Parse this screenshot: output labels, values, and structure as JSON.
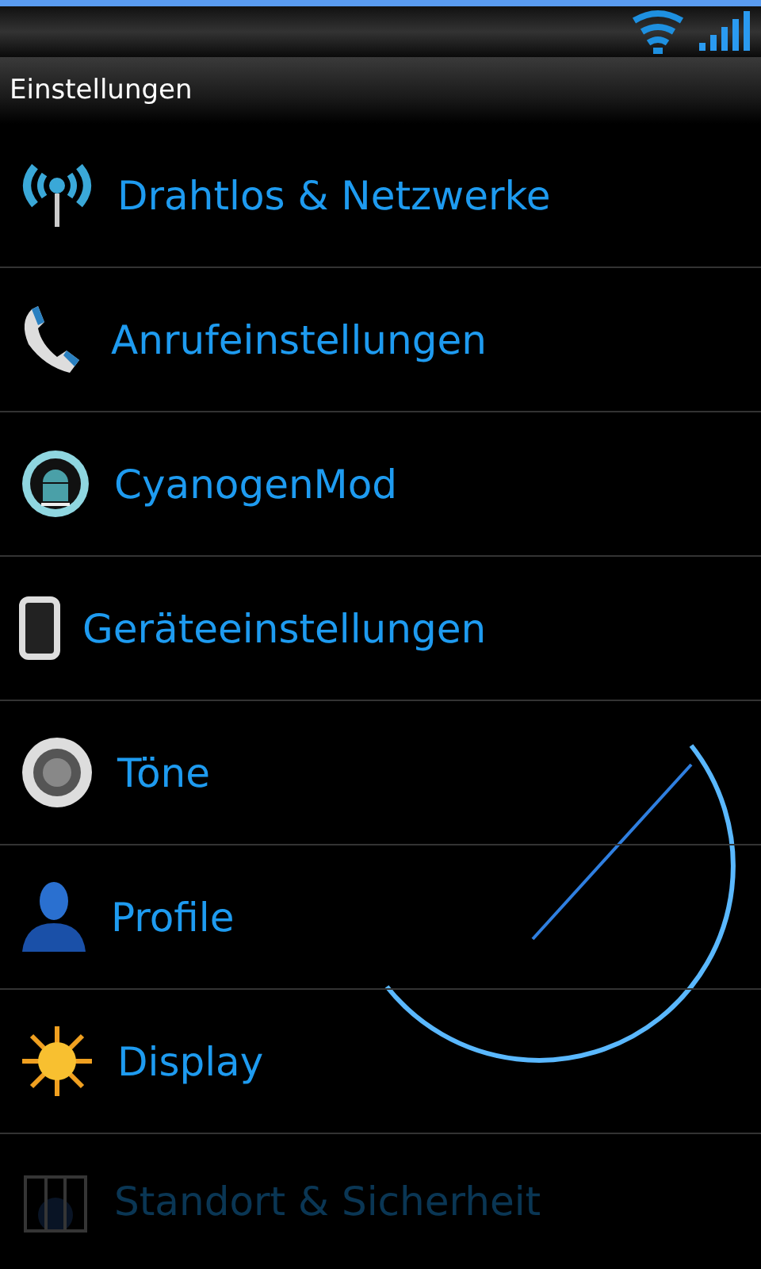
{
  "header": {
    "title": "Einstellungen"
  },
  "items": [
    {
      "kind": "wireless",
      "label": "Drahtlos & Netzwerke"
    },
    {
      "kind": "phone",
      "label": "Anrufeinstellungen"
    },
    {
      "kind": "cyanogen",
      "label": "CyanogenMod"
    },
    {
      "kind": "device",
      "label": "Geräteeinstellungen"
    },
    {
      "kind": "sound",
      "label": "Töne"
    },
    {
      "kind": "profile",
      "label": "Profile"
    },
    {
      "kind": "display",
      "label": "Display"
    },
    {
      "kind": "security",
      "label": "Standort & Sicherheit",
      "disabled": true
    }
  ]
}
